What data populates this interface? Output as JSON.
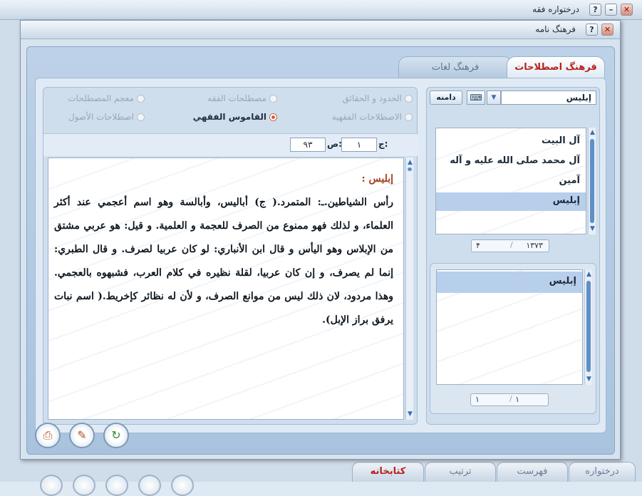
{
  "outer_window": {
    "title": "درختواره فقه",
    "buttons": {
      "close": "✕",
      "help": "?",
      "minimize": "–"
    },
    "bottom_tabs": [
      "درختواره",
      "فهرست",
      "ترتیب",
      "کتابخانه"
    ]
  },
  "inner_window": {
    "title": "فرهنگ نامه",
    "buttons": {
      "close": "✕",
      "help": "?"
    }
  },
  "tabs": {
    "active": "فرهنگ اصطلاحات",
    "inactive": "فرهنگ لغات"
  },
  "search": {
    "value": "إبليس",
    "button_label": "دامنه",
    "keyboard_icon": "keyboard-icon"
  },
  "radios": [
    {
      "label": "الحدود و الحقائق",
      "selected": false
    },
    {
      "label": "مصطلحات الفقه",
      "selected": false
    },
    {
      "label": "معجم المصطلحات",
      "selected": false
    },
    {
      "label": "الاصطلاحات الفقهية",
      "selected": false
    },
    {
      "label": "القاموس الفقهي",
      "selected": true
    },
    {
      "label": "اصطلاحات الأصول",
      "selected": false
    }
  ],
  "page_ref": {
    "volume_label": "ج:",
    "volume_value": "۱",
    "page_label": "ص:",
    "page_value": "۹۳"
  },
  "entry": {
    "heading": "إبليس :",
    "body": "رأس الشياطين.ـ: المتمرد.( ج) أباليس، وأبالسة وهو اسم أعجمي عند أكثر العلماء، و لذلك فهو ممنوع من الصرف للعجمة و العلمية. و قيل: هو عربي مشتق من الإبلاس وهو اليأس و قال ابن الأنباري: لو كان عربيا لصرف. و قال الطبري: إنما لم يصرف، و إن كان عربيا، لقلة نظيره في كلام العرب، فشبهوه بالعجمي. وهذا مردود، لان ذلك ليس من موانع الصرف، و لأن له نظائر كإخريط.( اسم نبات يرفق براز الإبل)."
  },
  "term_list": {
    "items": [
      "آل البيت",
      "آل محمد صلى الله عليه و آله",
      "آمين",
      "إبليس"
    ],
    "selected_index": 3,
    "counter_total": "۱۳۷۳",
    "counter_current": "۴"
  },
  "result_list": {
    "items": [
      "إبليس"
    ],
    "selected_index": 0,
    "counter_total": "۱",
    "counter_current": "۱"
  },
  "toolbar": [
    "print-icon",
    "edit-icon",
    "export-icon"
  ],
  "colors": {
    "accent_red": "#b8221a",
    "selection": "#b8cfec",
    "panel_blue": "#cfdeed"
  }
}
